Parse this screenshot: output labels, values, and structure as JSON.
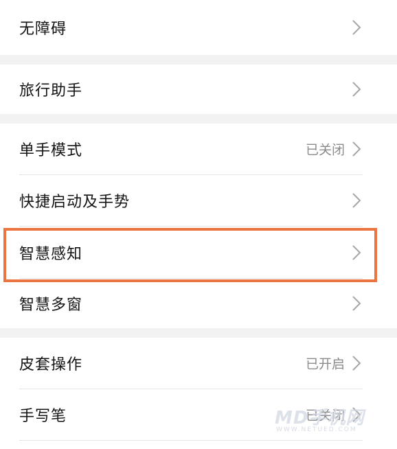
{
  "settings": {
    "items": [
      {
        "label": "无障碍",
        "status": ""
      },
      {
        "label": "旅行助手",
        "status": ""
      },
      {
        "label": "单手模式",
        "status": "已关闭"
      },
      {
        "label": "快捷启动及手势",
        "status": ""
      },
      {
        "label": "智慧感知",
        "status": ""
      },
      {
        "label": "智慧多窗",
        "status": ""
      },
      {
        "label": "皮套操作",
        "status": "已开启"
      },
      {
        "label": "手写笔",
        "status": "已关闭"
      }
    ],
    "chevron_icon": "chevron-right-icon"
  },
  "highlight": {
    "color": "#ec7440",
    "target": "智慧感知"
  },
  "watermark": {
    "brand": "MD手机网",
    "url": "WWW.NETUED.COM"
  },
  "colors": {
    "section_gap": "#f2f2f2",
    "status_text": "#8a8a8a",
    "divider": "#e4e4e4"
  }
}
